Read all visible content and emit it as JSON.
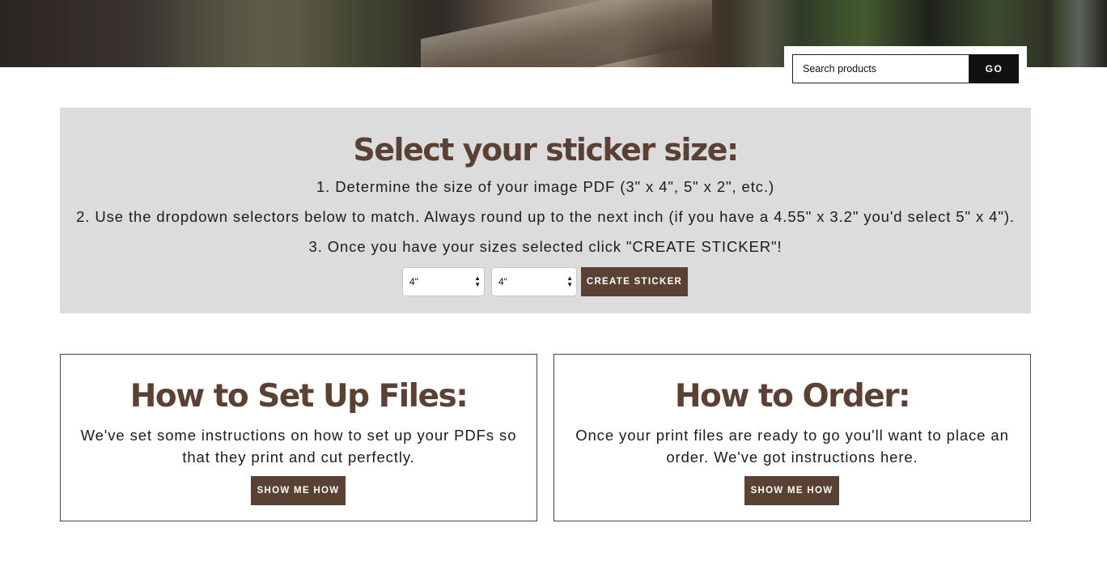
{
  "header": {
    "search": {
      "placeholder": "Search products",
      "value": ""
    },
    "go_label": "GO"
  },
  "size_panel": {
    "title": "Select your sticker size:",
    "steps": [
      "1. Determine the size of your image PDF (3\" x 4\", 5\" x 2\", etc.)",
      "2. Use the dropdown selectors below to match. Always round up to the next inch (if you have a 4.55\" x 3.2\" you'd select 5\" x 4\").",
      "3. Once you have your sizes selected click \"CREATE STICKER\"!"
    ],
    "width_select": {
      "value": "4\""
    },
    "height_select": {
      "value": "4\""
    },
    "create_label": "CREATE STICKER"
  },
  "cards": [
    {
      "title": "How to Set Up Files:",
      "text": "We've set some instructions on how to set up your PDFs so that they print and cut perfectly.",
      "button": "SHOW ME HOW"
    },
    {
      "title": "How to Order:",
      "text": "Once your print files are ready to go you'll want to place an order. We've got instructions here.",
      "button": "SHOW ME HOW"
    }
  ],
  "colors": {
    "brand_brown": "#5a4133",
    "panel_gray": "#dcdcdc",
    "black": "#111111"
  }
}
